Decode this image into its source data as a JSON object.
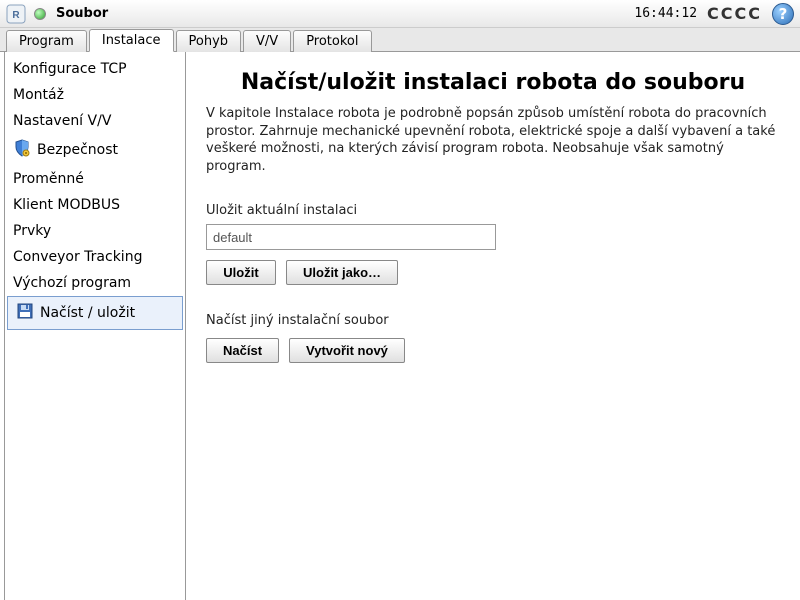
{
  "topbar": {
    "title": "Soubor",
    "time": "16:44:12",
    "indicator": "CCCC"
  },
  "tabs": [
    {
      "label": "Program"
    },
    {
      "label": "Instalace"
    },
    {
      "label": "Pohyb"
    },
    {
      "label": "V/V"
    },
    {
      "label": "Protokol"
    }
  ],
  "active_tab_index": 1,
  "sidebar": {
    "items": [
      {
        "label": "Konfigurace TCP"
      },
      {
        "label": "Montáž"
      },
      {
        "label": "Nastavení V/V"
      },
      {
        "label": "Bezpečnost"
      },
      {
        "label": "Proměnné"
      },
      {
        "label": "Klient MODBUS"
      },
      {
        "label": "Prvky"
      },
      {
        "label": "Conveyor Tracking"
      },
      {
        "label": "Výchozí program"
      },
      {
        "label": "Načíst / uložit"
      }
    ],
    "selected_index": 9
  },
  "main": {
    "heading": "Načíst/uložit instalaci robota do souboru",
    "description": "V kapitole Instalace robota je podrobně popsán způsob umístění robota do pracovních prostor. Zahrnuje mechanické upevnění robota, elektrické spoje a další vybavení a také veškeré možnosti, na kterých závisí program robota. Neobsahuje však samotný program.",
    "save_section_label": "Uložit aktuální instalaci",
    "filename_value": "default",
    "save_label": "Uložit",
    "save_as_label": "Uložit jako…",
    "load_section_label": "Načíst jiný instalační soubor",
    "load_label": "Načíst",
    "create_new_label": "Vytvořit nový"
  }
}
